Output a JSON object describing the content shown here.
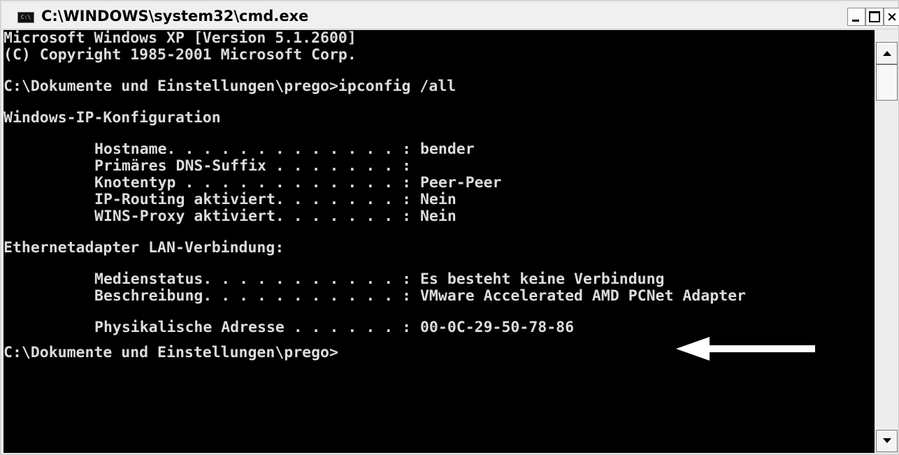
{
  "window": {
    "title": "C:\\WINDOWS\\system32\\cmd.exe",
    "icon_text": "C:\\",
    "buttons": {
      "minimize": "minimize",
      "maximize": "maximize",
      "close": "×"
    }
  },
  "console": {
    "banner": [
      "Microsoft Windows XP [Version 5.1.2600]",
      "(C) Copyright 1985-2001 Microsoft Corp."
    ],
    "command": "C:\\Dokumente und Einstellungen\\prego>ipconfig /all",
    "section_ip": "Windows-IP-Konfiguration",
    "ip_config": [
      "Hostname. . . . . . . . . . . . . : bender",
      "Primäres DNS-Suffix . . . . . . . :",
      "Knotentyp . . . . . . . . . . . . : Peer-Peer",
      "IP-Routing aktiviert. . . . . . . : Nein",
      "WINS-Proxy aktiviert. . . . . . . : Nein"
    ],
    "section_eth": "Ethernetadapter LAN-Verbindung:",
    "eth_config": [
      "Medienstatus. . . . . . . . . . . : Es besteht keine Verbindung",
      "Beschreibung. . . . . . . . . . . : VMware Accelerated AMD PCNet Adapter"
    ],
    "mac_line": "Physikalische Adresse . . . . . . : 00-0C-29-50-78-86",
    "prompt": "C:\\Dokumente und Einstellungen\\prego>"
  },
  "annotation": {
    "arrow_color": "#ffffff",
    "points_to": "mac_line"
  },
  "colors": {
    "console_bg": "#000000",
    "console_fg": "#dcdcdc"
  }
}
